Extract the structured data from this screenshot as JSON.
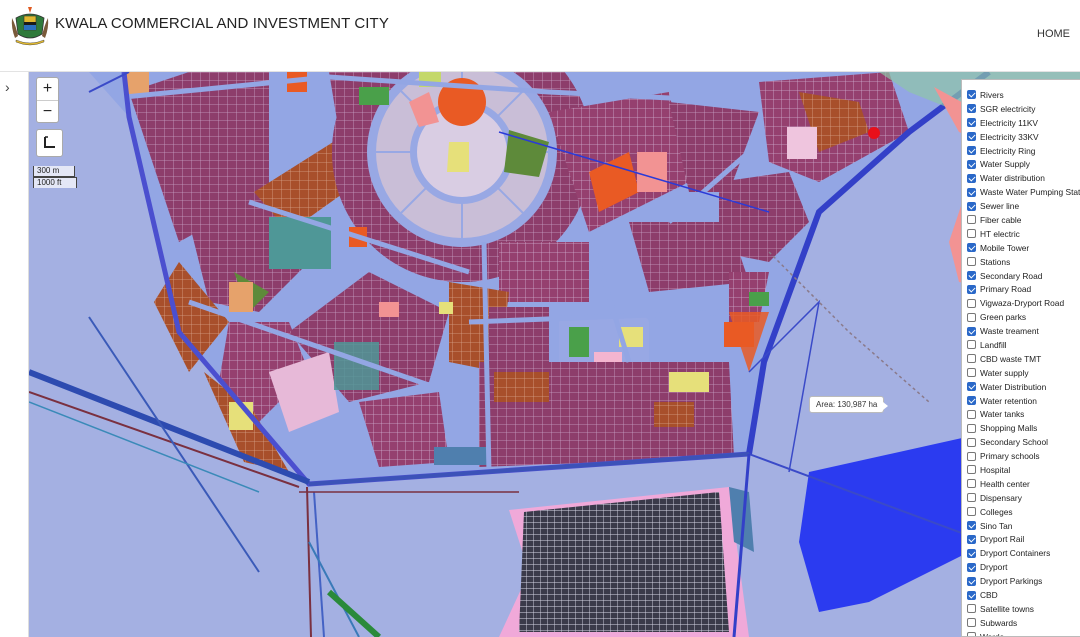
{
  "header": {
    "title": "KWALA COMMERCIAL AND INVESTMENT CITY",
    "nav_home": "HOME"
  },
  "map": {
    "zoom_in": "+",
    "zoom_out": "−",
    "scale_metric": "300 m",
    "scale_imperial": "1000 ft",
    "area_tooltip": "Area: 130,987 ha"
  },
  "colors": {
    "background": "#a4b0e2",
    "plot_residential": "#8d3d6b",
    "plot_commercial": "#a84f2b",
    "roads": "#8fa5e6",
    "center": "#e95a24",
    "marker": "#e8101a"
  },
  "layers": [
    {
      "label": "Rivers",
      "checked": true
    },
    {
      "label": "SGR electricity",
      "checked": true
    },
    {
      "label": "Electricity 11KV",
      "checked": true
    },
    {
      "label": "Electricity 33KV",
      "checked": true
    },
    {
      "label": "Electricity Ring",
      "checked": true
    },
    {
      "label": "Water Supply",
      "checked": true
    },
    {
      "label": "Water distribution",
      "checked": true
    },
    {
      "label": "Waste Water Pumping Station",
      "checked": true
    },
    {
      "label": "Sewer line",
      "checked": true
    },
    {
      "label": "Fiber cable",
      "checked": false
    },
    {
      "label": "HT electric",
      "checked": false
    },
    {
      "label": "Mobile Tower",
      "checked": true
    },
    {
      "label": "Stations",
      "checked": false
    },
    {
      "label": "Secondary Road",
      "checked": true
    },
    {
      "label": "Primary Road",
      "checked": true
    },
    {
      "label": "Vigwaza-Dryport Road",
      "checked": false
    },
    {
      "label": "Green parks",
      "checked": false
    },
    {
      "label": "Waste treament",
      "checked": true
    },
    {
      "label": "Landfill",
      "checked": false
    },
    {
      "label": "CBD waste TMT",
      "checked": false
    },
    {
      "label": "Water supply",
      "checked": false
    },
    {
      "label": "Water Distribution",
      "checked": true
    },
    {
      "label": "Water retention",
      "checked": true
    },
    {
      "label": "Water tanks",
      "checked": false
    },
    {
      "label": "Shopping Malls",
      "checked": false
    },
    {
      "label": "Secondary School",
      "checked": false
    },
    {
      "label": "Primary schools",
      "checked": false
    },
    {
      "label": "Hospital",
      "checked": false
    },
    {
      "label": "Health center",
      "checked": false
    },
    {
      "label": "Dispensary",
      "checked": false
    },
    {
      "label": "Colleges",
      "checked": false
    },
    {
      "label": "Sino Tan",
      "checked": true
    },
    {
      "label": "Dryport Rail",
      "checked": true
    },
    {
      "label": "Dryport Containers",
      "checked": true
    },
    {
      "label": "Dryport",
      "checked": true
    },
    {
      "label": "Dryport Parkings",
      "checked": true
    },
    {
      "label": "CBD",
      "checked": true
    },
    {
      "label": "Satellite towns",
      "checked": false
    },
    {
      "label": "Subwards",
      "checked": false
    },
    {
      "label": "Wards",
      "checked": false
    }
  ]
}
